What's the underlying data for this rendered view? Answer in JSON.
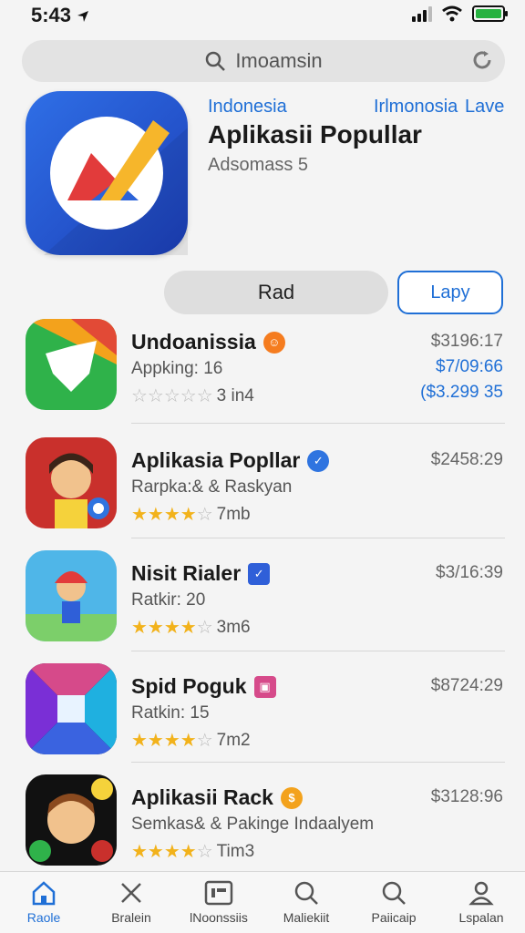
{
  "status_bar": {
    "time": "5:43",
    "location_arrow": "location-arrow-icon"
  },
  "search": {
    "text": "Imoamsin"
  },
  "hero": {
    "link_left": "Indonesia",
    "link_mid": "Irlmonosia",
    "link_right": "Lave",
    "title": "Aplikasii Popullar",
    "subtitle": "Adsomass 5",
    "primary_button": "Rad",
    "secondary_button": "Lapy"
  },
  "apps": [
    {
      "name": "Undoanissia",
      "sub": "Appking: 16",
      "rating_text": "3 in4",
      "stars": 0,
      "price": "$3196:17",
      "price2": "$7/09:66",
      "price3": "($3.299 35",
      "badge_color": "#f57c1f"
    },
    {
      "name": "Aplikasia Popllar",
      "sub": "Rarpka:& & Raskyan",
      "rating_text": "7mb",
      "stars": 4,
      "price": "$2458:29",
      "badge_color": "#2f74e0"
    },
    {
      "name": "Nisit Rialer",
      "sub": "Ratkir: 20",
      "rating_text": "3m6",
      "stars": 4,
      "price": "$3/16:39",
      "badge_color": "#2f5fd8"
    },
    {
      "name": "Spid Poguk",
      "sub": "Ratkin: 15",
      "rating_text": "7m2",
      "stars": 4,
      "price": "$8724:29",
      "badge_color": "#d64a8a"
    },
    {
      "name": "Aplikasii Rack",
      "sub": "Semkas& & Pakinge Indaalyem",
      "rating_text": "Tim3",
      "stars": 4,
      "price": "$3128:96",
      "badge_color": "#f3a21c"
    }
  ],
  "tabs": [
    {
      "label": "Raole",
      "icon": "home-icon",
      "active": true
    },
    {
      "label": "Bralein",
      "icon": "close-icon",
      "active": false
    },
    {
      "label": "lNoonssiis",
      "icon": "card-icon",
      "active": false
    },
    {
      "label": "Maliekiit",
      "icon": "search-icon",
      "active": false
    },
    {
      "label": "Paiicaip",
      "icon": "search-icon",
      "active": false
    },
    {
      "label": "Lspalan",
      "icon": "profile-icon",
      "active": false
    }
  ],
  "colors": {
    "accent": "#1f6fd6",
    "star": "#f2b21b"
  }
}
